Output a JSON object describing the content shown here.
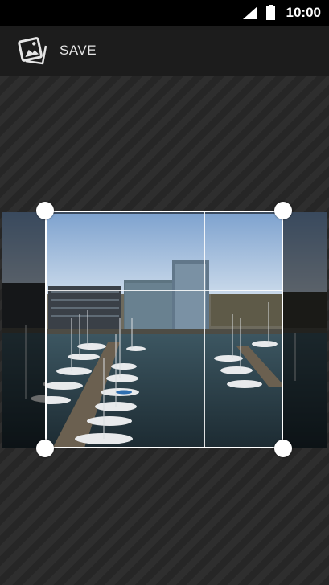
{
  "status_bar": {
    "time": "10:00",
    "icons": [
      "signal-icon",
      "battery-icon"
    ]
  },
  "action_bar": {
    "save_label": "SAVE",
    "save_icon": "photo-icon"
  },
  "colors": {
    "status_bar_bg": "#000000",
    "action_bar_bg": "#1c1c1c",
    "workspace_bg": "#2a2a2a",
    "crop_frame": "#ffffff"
  }
}
